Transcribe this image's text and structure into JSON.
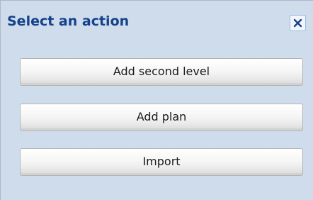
{
  "dialog": {
    "title": "Select an action",
    "close_icon": "close-icon",
    "actions": [
      {
        "label": "Add second level"
      },
      {
        "label": "Add plan"
      },
      {
        "label": "Import"
      }
    ]
  },
  "colors": {
    "background": "#cfdcec",
    "title": "#15428b",
    "close_border": "#99bbe8",
    "close_glyph": "#15428b"
  }
}
